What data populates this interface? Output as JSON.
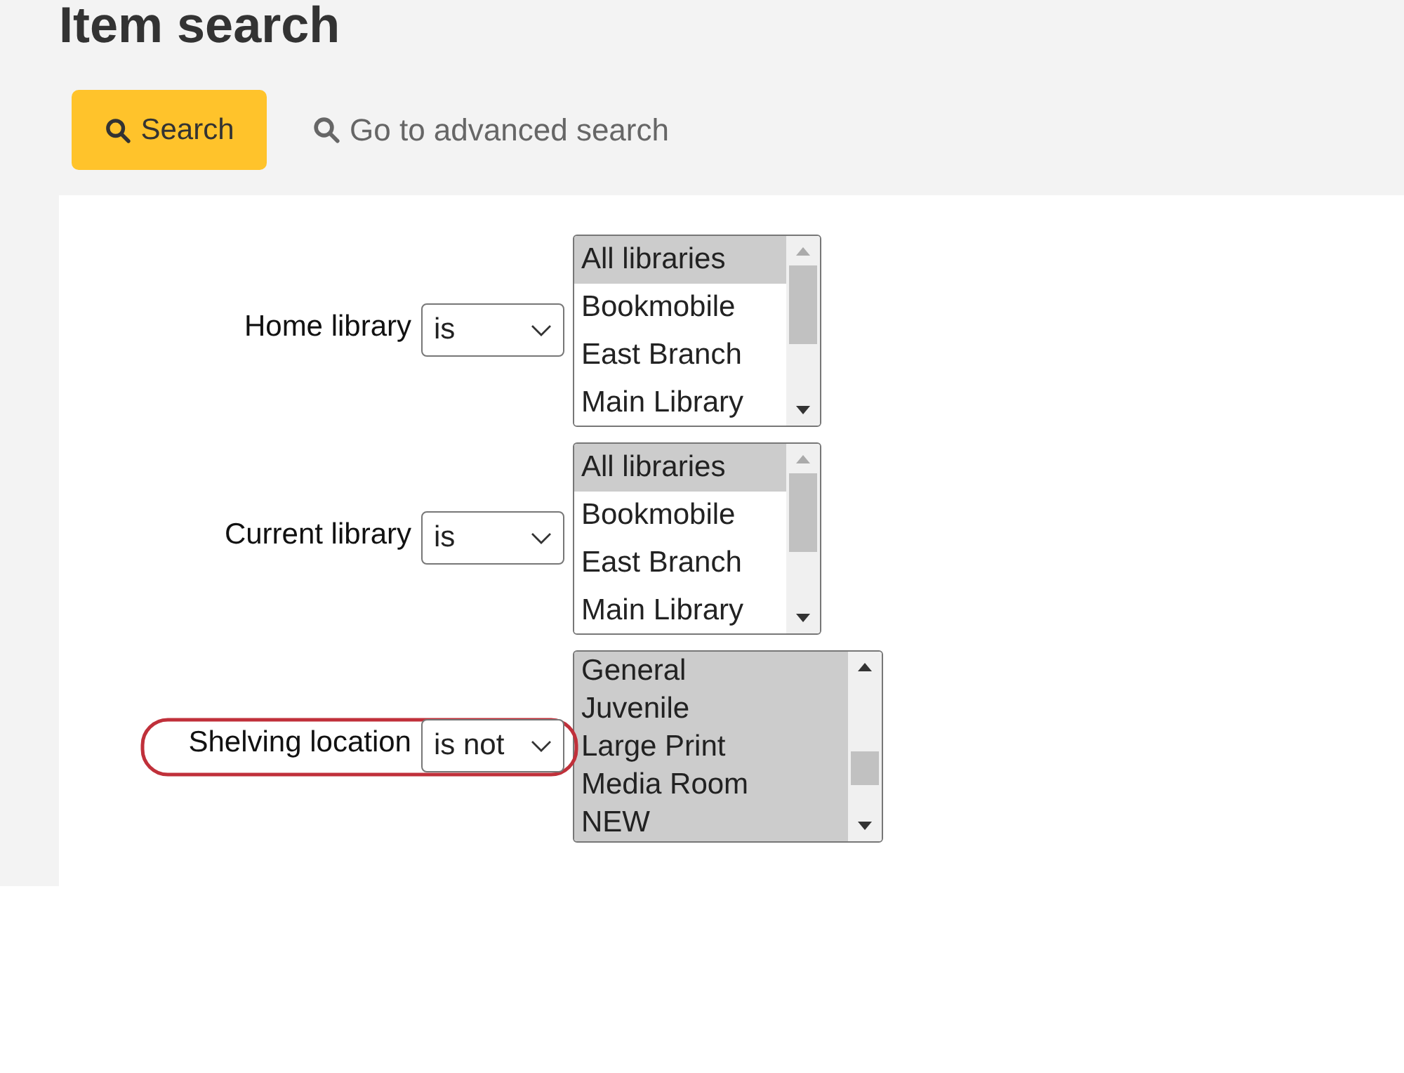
{
  "page_title": "Item search",
  "actions": {
    "search_button": "Search",
    "advanced_link": "Go to advanced search"
  },
  "rows": [
    {
      "label": "Home library",
      "operator": "is",
      "highlighted": false,
      "scrolled": false,
      "options": [
        {
          "label": "All libraries",
          "selected": true
        },
        {
          "label": "Bookmobile",
          "selected": false
        },
        {
          "label": "East Branch",
          "selected": false
        },
        {
          "label": "Main Library",
          "selected": false
        }
      ]
    },
    {
      "label": "Current library",
      "operator": "is",
      "highlighted": false,
      "scrolled": false,
      "options": [
        {
          "label": "All libraries",
          "selected": true
        },
        {
          "label": "Bookmobile",
          "selected": false
        },
        {
          "label": "East Branch",
          "selected": false
        },
        {
          "label": "Main Library",
          "selected": false
        }
      ]
    },
    {
      "label": "Shelving location",
      "operator": "is not",
      "highlighted": true,
      "scrolled": true,
      "options": [
        {
          "label": "General",
          "selected": true
        },
        {
          "label": "Juvenile",
          "selected": true
        },
        {
          "label": "Large Print",
          "selected": true
        },
        {
          "label": "Media Room",
          "selected": true
        },
        {
          "label": "NEW",
          "selected": true
        }
      ]
    }
  ]
}
